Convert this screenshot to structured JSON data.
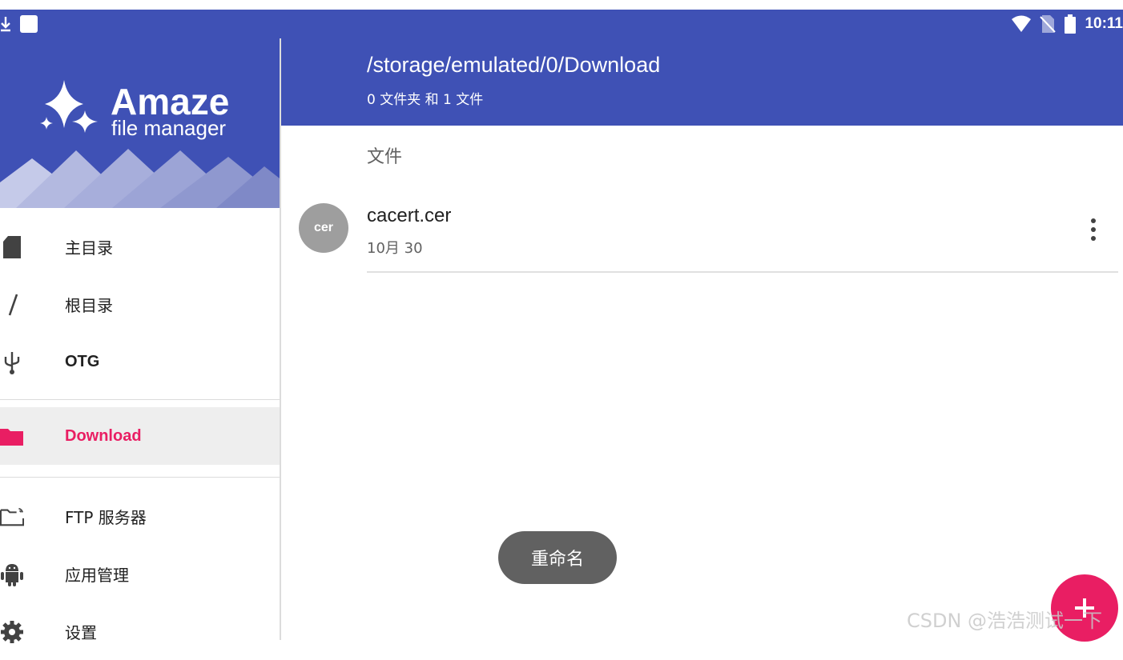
{
  "status_bar": {
    "time": "10:11",
    "left_icons": [
      "download-icon",
      "square-notification-icon"
    ],
    "right_icons": [
      "wifi-icon",
      "no-sim-icon",
      "battery-icon"
    ]
  },
  "drawer": {
    "logo_title": "Amaze",
    "logo_subtitle": "file manager",
    "items": [
      {
        "label": "主目录",
        "icon": "sd-card-icon"
      },
      {
        "label": "根目录",
        "icon": "slash-icon"
      },
      {
        "label": "OTG",
        "icon": "usb-icon"
      },
      {
        "label": "Download",
        "icon": "folder-icon",
        "active": true
      },
      {
        "label": "FTP 服务器",
        "icon": "ftp-folder-icon"
      },
      {
        "label": "应用管理",
        "icon": "android-icon"
      },
      {
        "label": "设置",
        "icon": "gear-icon"
      }
    ]
  },
  "appbar": {
    "path": "/storage/emulated/0/Download",
    "summary": "0 文件夹 和 1 文件"
  },
  "files": {
    "section_header": "文件",
    "items": [
      {
        "avatar": "cer",
        "name": "cacert.cer",
        "date": "10月 30"
      }
    ]
  },
  "toast": "重命名",
  "fab": {
    "icon": "plus-icon"
  },
  "watermark": "CSDN @浩浩测试一下",
  "colors": {
    "primary": "#3f51b5",
    "accent": "#e91e63",
    "avatar": "#9e9e9e",
    "toast": "#616161"
  }
}
